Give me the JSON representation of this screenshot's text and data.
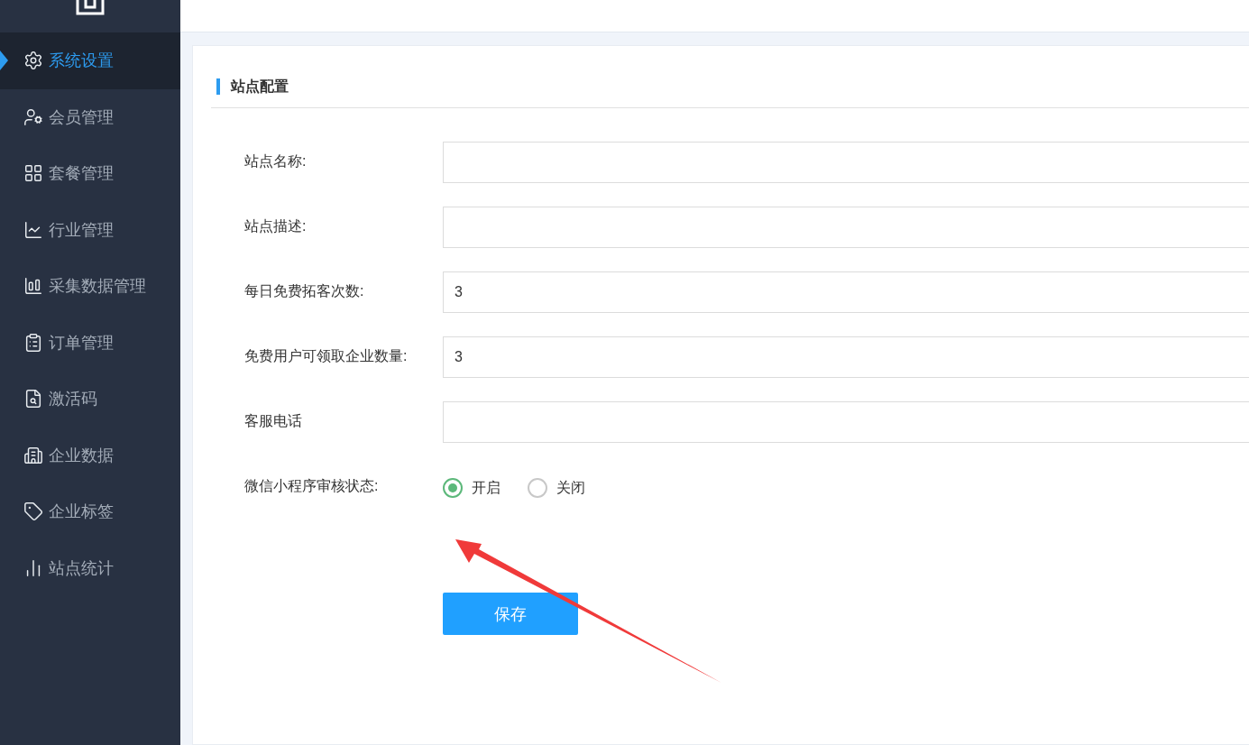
{
  "sidebar": {
    "items": [
      {
        "label": "系统设置",
        "selected": true
      },
      {
        "label": "会员管理",
        "selected": false
      },
      {
        "label": "套餐管理",
        "selected": false
      },
      {
        "label": "行业管理",
        "selected": false
      },
      {
        "label": "采集数据管理",
        "selected": false
      },
      {
        "label": "订单管理",
        "selected": false
      },
      {
        "label": "激活码",
        "selected": false
      },
      {
        "label": "企业数据",
        "selected": false
      },
      {
        "label": "企业标签",
        "selected": false
      },
      {
        "label": "站点统计",
        "selected": false
      }
    ]
  },
  "card": {
    "title": "站点配置",
    "fields": [
      {
        "kind": "input",
        "label": "站点名称:"
      },
      {
        "kind": "input",
        "label": "站点描述:"
      },
      {
        "kind": "input",
        "label": "每日免费拓客次数:",
        "value": "3"
      },
      {
        "kind": "input",
        "label": "免费用户可领取企业数量:",
        "value": "3"
      },
      {
        "kind": "input",
        "label": "客服电话"
      },
      {
        "kind": "radio",
        "label": "微信小程序审核状态:",
        "options": [
          {
            "label": "开启",
            "selected": true
          },
          {
            "label": "关闭",
            "selected": false
          }
        ]
      }
    ],
    "save_button": "保存"
  }
}
